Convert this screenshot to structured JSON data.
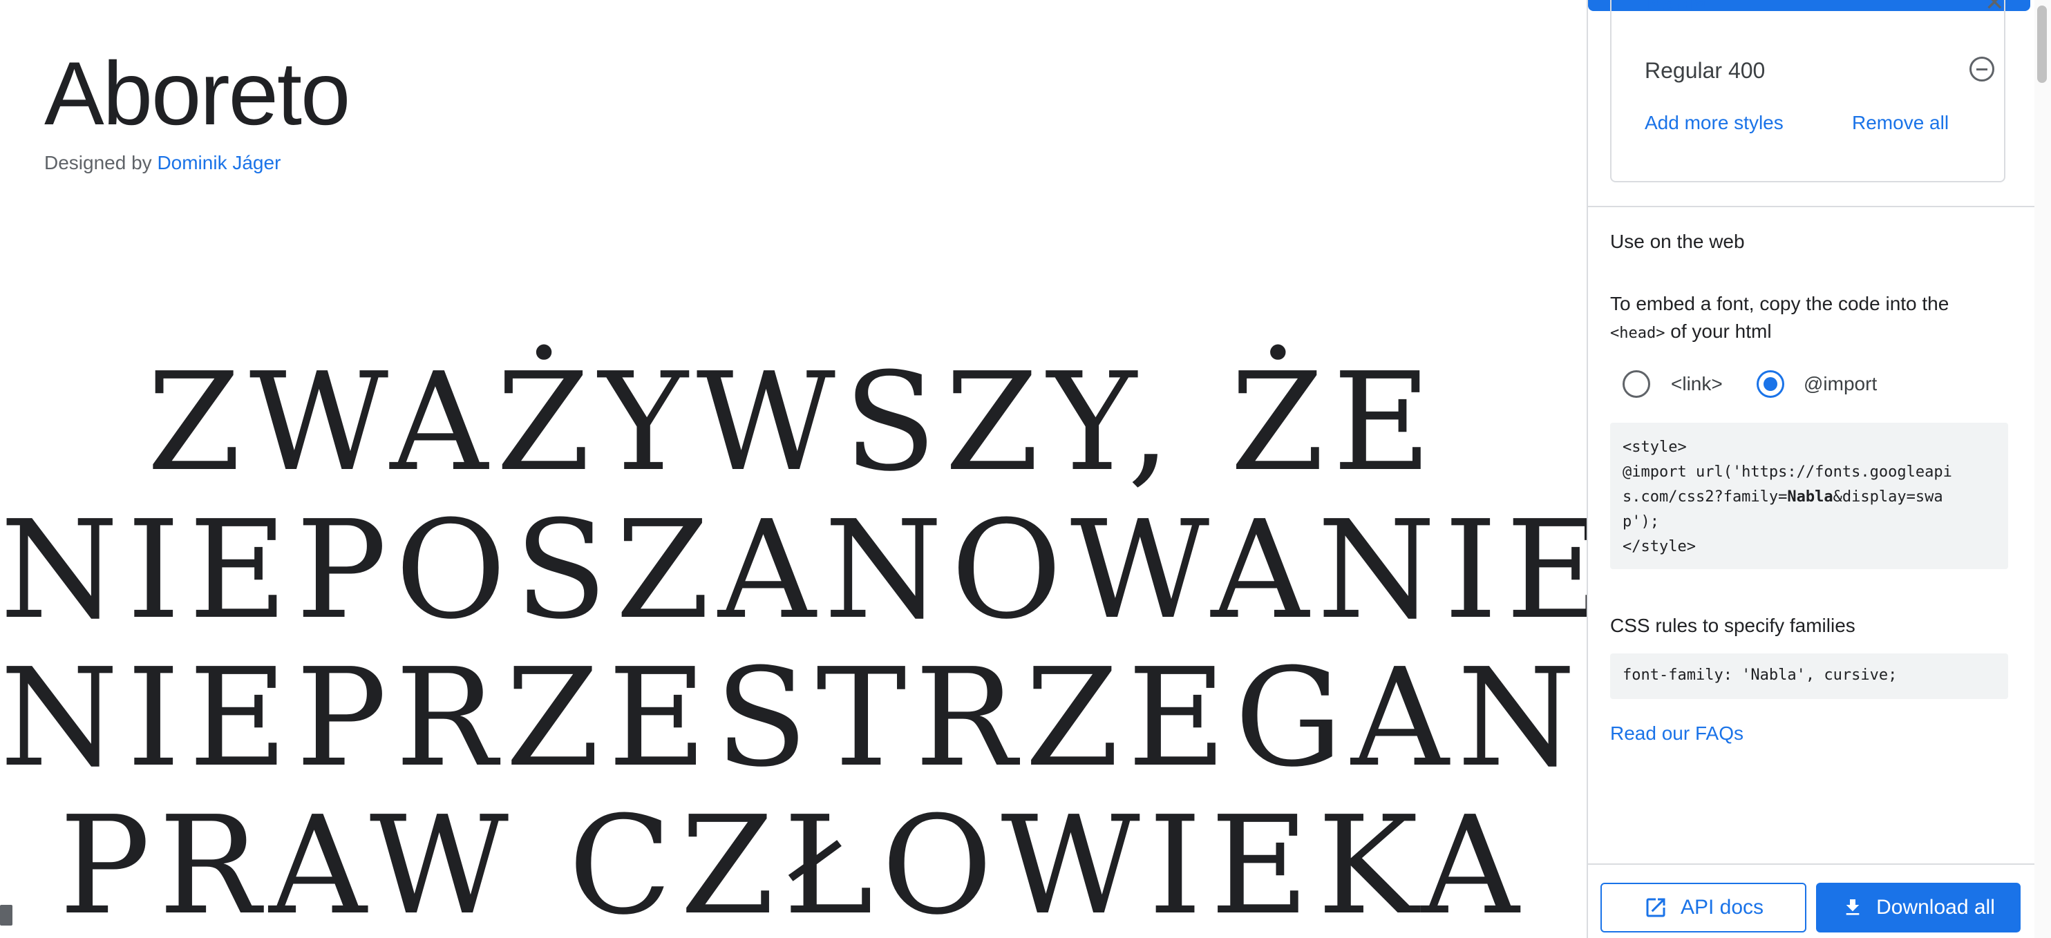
{
  "font": {
    "title": "Aboreto",
    "designed_by_prefix": "Designed by",
    "designer": "Dominik Jáger"
  },
  "specimen": {
    "lines": [
      "ZWAŻYWSZY, ŻE",
      "NIEPOSZANOWANIE I",
      "NIEPRZESTRZEGANIE",
      "PRAW CZŁOWIEKA"
    ]
  },
  "panel": {
    "selected_family": "Nabla",
    "selected_style": "Regular 400",
    "add_more_styles": "Add more styles",
    "remove_all": "Remove all",
    "use_on_web_title": "Use on the web",
    "embed_text_1": "To embed a font, copy the code into the",
    "embed_code_tag": "<head>",
    "embed_text_2": "of your html",
    "radio_link": "<link>",
    "radio_import": "@import",
    "selected_method": "@import",
    "code": {
      "line1": "<style>",
      "line2": "@import url('https://fonts.googleapi",
      "line3_pre": "s.com/css2?family=",
      "line3_bold": "Nabla",
      "line3_post": "&display=swa",
      "line4": "p');",
      "line5": "</style>"
    },
    "css_rules_title": "CSS rules to specify families",
    "css_rule": "font-family: 'Nabla', cursive;",
    "faq_link": "Read our FAQs",
    "api_docs": "API docs",
    "download_all": "Download all"
  },
  "colors": {
    "accent": "#1a73e8",
    "text": "#202124",
    "code_bg": "#f1f3f4"
  },
  "icons": {
    "close": "close-icon",
    "remove_style": "remove-circle-icon",
    "api_docs": "open-in-new-icon",
    "download": "download-icon"
  }
}
